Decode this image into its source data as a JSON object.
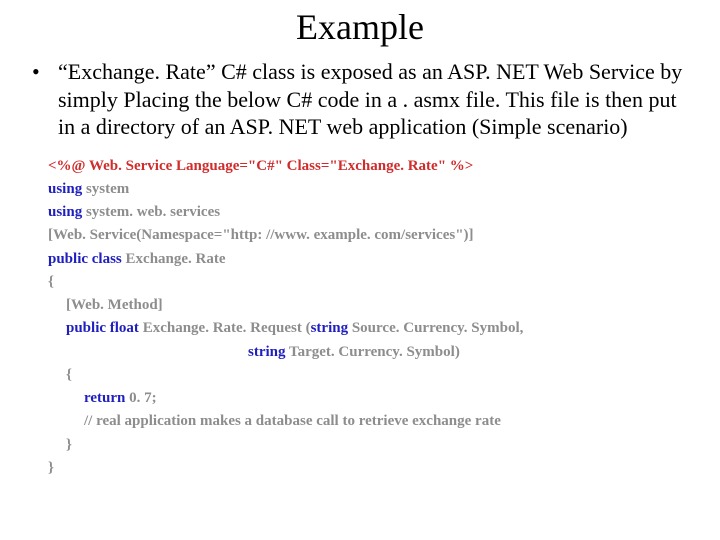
{
  "title": "Example",
  "bullet": "“Exchange. Rate” C# class is exposed as an ASP. NET Web Service by simply Placing the below C# code  in a . asmx file. This file is then put in a directory of an ASP. NET web application (Simple scenario)",
  "code": {
    "l1": "<%@ Web. Service Language=\"C#\" Class=\"Exchange. Rate\" %>",
    "l2a": "using",
    "l2b": " system",
    "l3a": "using",
    "l3b": " system. web. services",
    "l4": "[Web. Service(Namespace=\"http: //www. example. com/services\")]",
    "l5a": "public class",
    "l5b": " Exchange. Rate",
    "l6": "{",
    "l7": "[Web. Method]",
    "l8a": "public float",
    "l8b": " Exchange. Rate. Request (",
    "l8c": "string",
    "l8d": " Source. Currency. Symbol,",
    "l9a": "string",
    "l9b": " Target. Currency. Symbol)",
    "l10": "{",
    "l11a": "return",
    "l11b": " 0. 7;",
    "l12": "// real application makes a database call to retrieve exchange rate",
    "l13": "}",
    "l14": "}"
  }
}
